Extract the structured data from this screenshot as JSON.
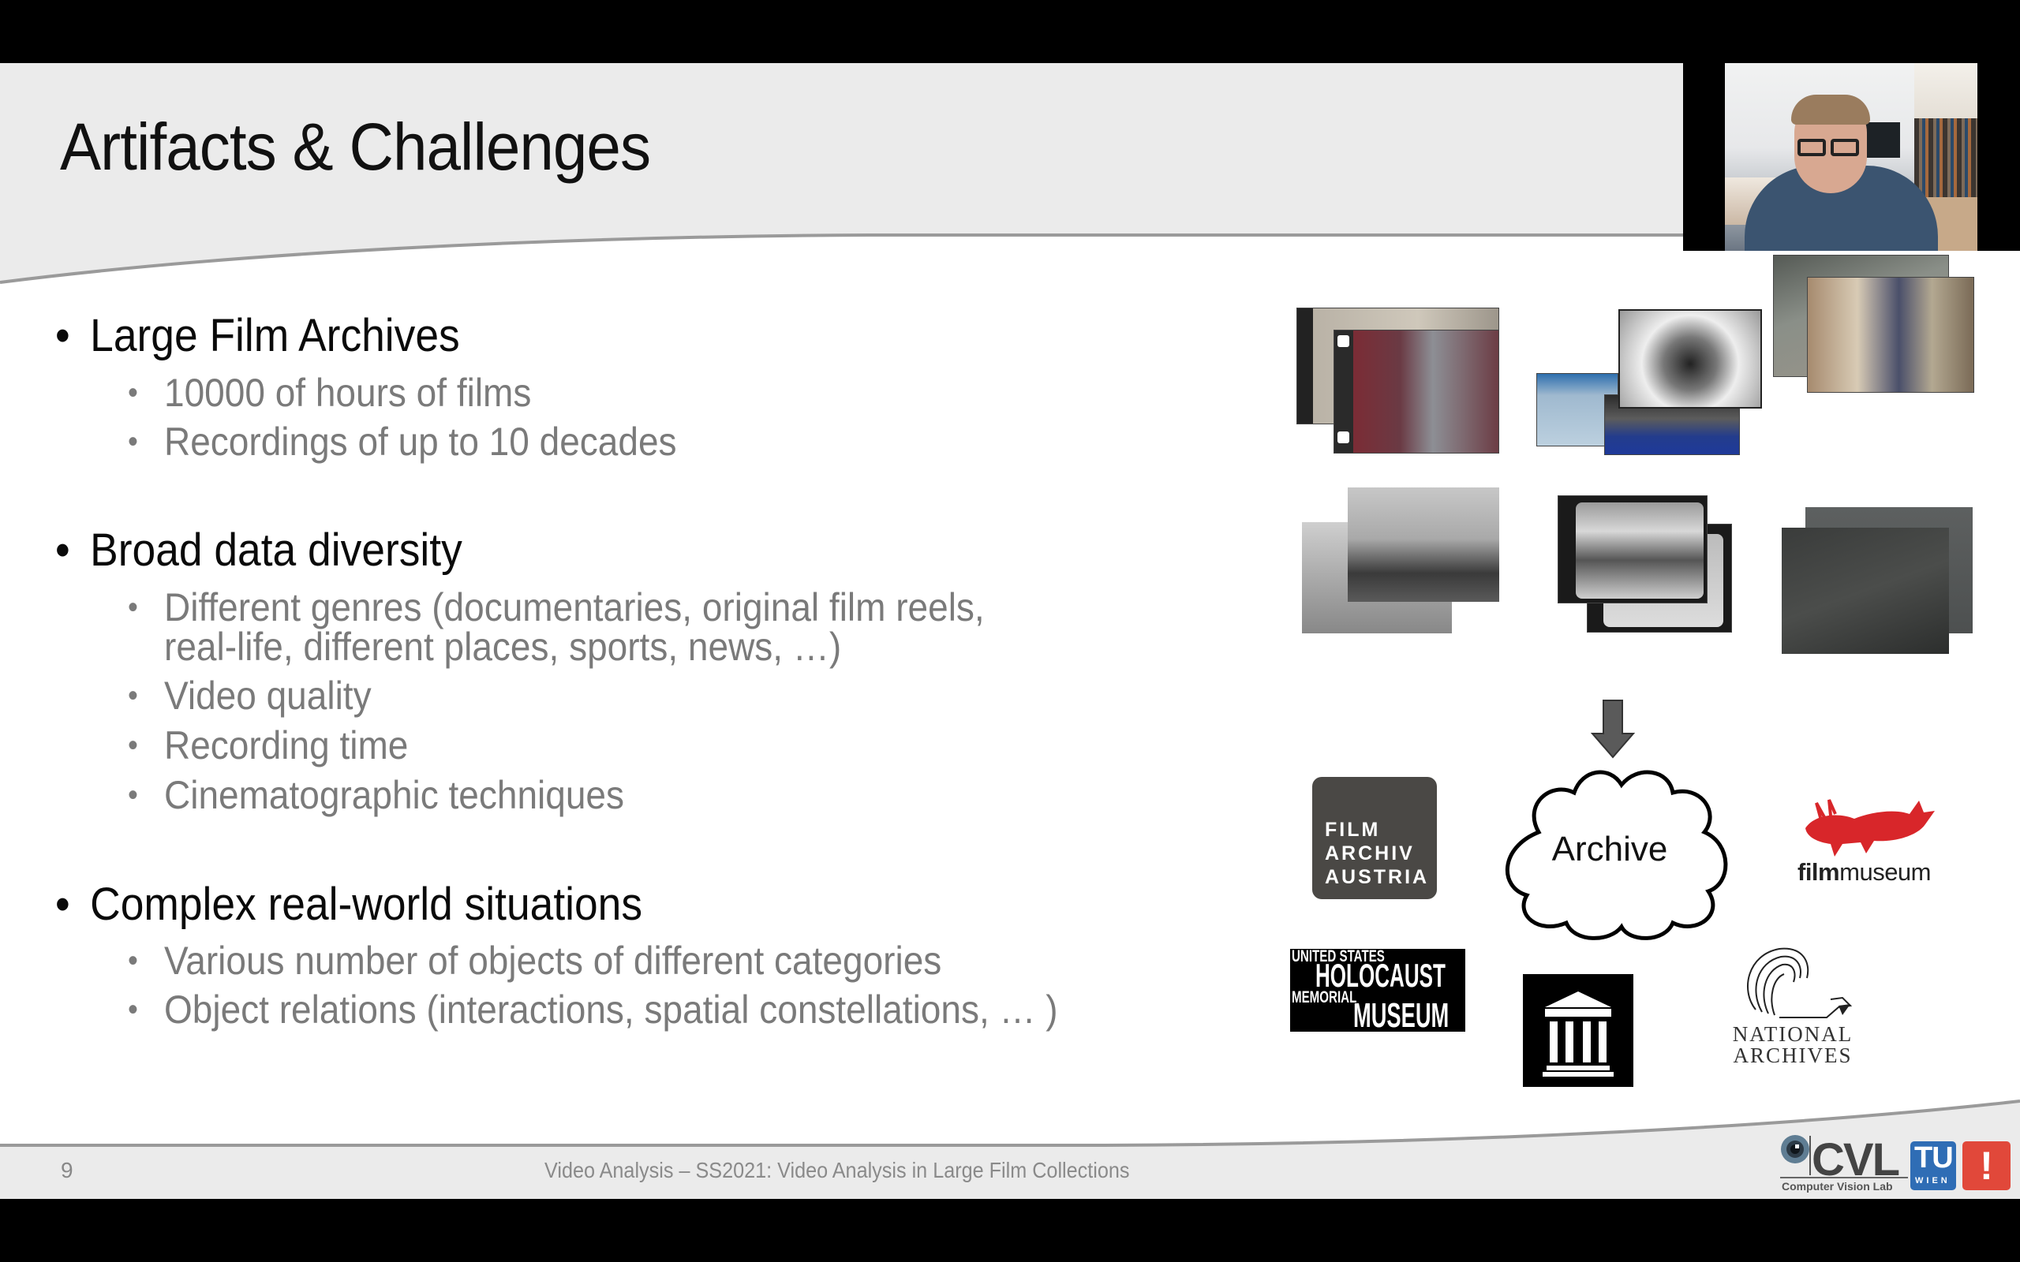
{
  "slide": {
    "title": "Artifacts & Challenges",
    "bullets": [
      {
        "text": "Large Film Archives",
        "sub": [
          "10000 of hours of films",
          "Recordings of up to 10 decades"
        ]
      },
      {
        "text": "Broad data diversity",
        "sub": [
          "Different genres (documentaries, original film reels,",
          "real-life, different places, sports, news, …)",
          "Video quality",
          "Recording time",
          "Cinematographic techniques"
        ]
      },
      {
        "text": "Complex real-world situations",
        "sub": [
          "Various number of objects of different categories",
          "Object relations (interactions, spatial constellations, … )"
        ]
      }
    ],
    "bullet_glyph": "•",
    "diagram": {
      "cloud_label": "Archive",
      "film_thumbnails": [
        "film-reel-frames",
        "news-broadcast-frames",
        "western-movie-frames",
        "boxing-match-frames",
        "film-strip-frames",
        "war-footage-frames"
      ],
      "logos": {
        "film_archiv_austria": [
          "FILM",
          "ARCHIV",
          "AUSTRIA"
        ],
        "filmmuseum": {
          "bold": "film",
          "regular": "museum"
        },
        "holocaust_museum": [
          "UNITED STATES",
          "HOLOCAUST",
          "MEMORIAL",
          "MUSEUM"
        ],
        "national_archives": [
          "NATIONAL",
          "ARCHIVES"
        ],
        "internet_archive": "building-icon"
      }
    },
    "footer": {
      "page_number": "9",
      "text": "Video Analysis – SS2021: Video Analysis in Large Film Collections",
      "cvl_logo": "CVL",
      "cvl_subtitle": "Computer Vision Lab",
      "tu_logo": "TU",
      "tu_subtitle": "WIEN",
      "exclamation": "!"
    }
  },
  "webcam": {
    "label": "presenter-video"
  },
  "colors": {
    "title_band": "#ebebeb",
    "curve_line": "#9a9a9a",
    "primary_text": "#0a0a0a",
    "secondary_text": "#7a7a7a",
    "tu_blue": "#2f6db5",
    "accent_red": "#e1483a",
    "filmmuseum_red": "#d8262a",
    "faa_gray": "#4a4845"
  }
}
